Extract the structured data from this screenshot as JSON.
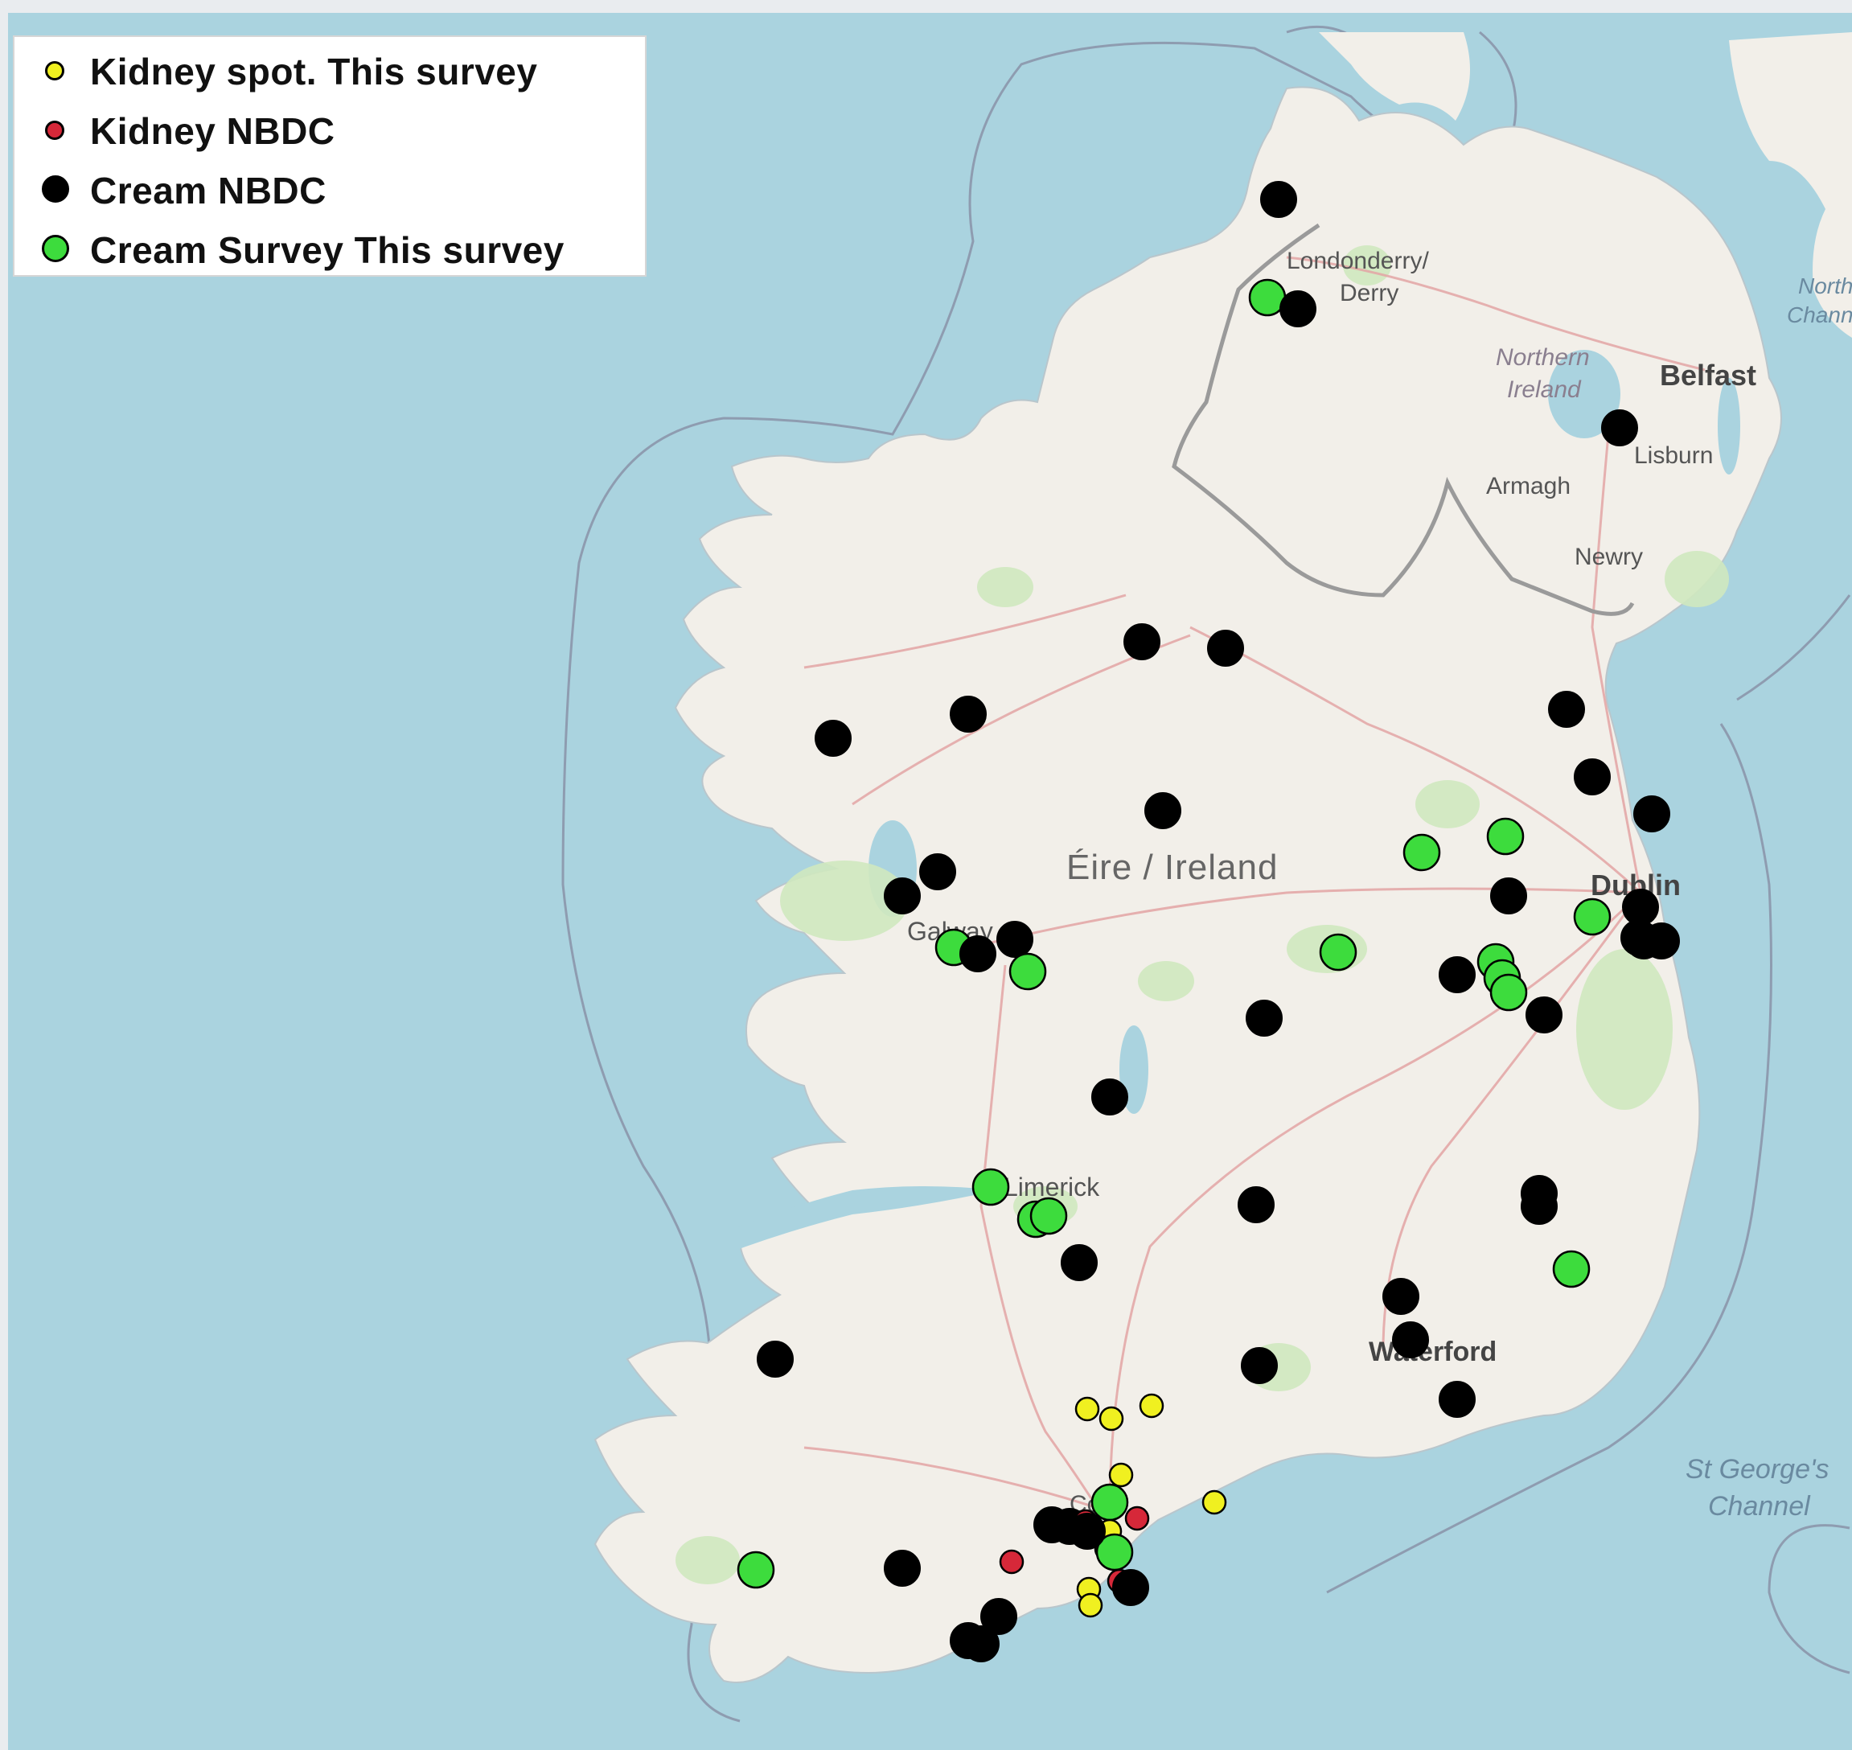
{
  "legend": {
    "items": [
      {
        "label": "Kidney spot. This survey",
        "color": "#f0f020",
        "size": "small"
      },
      {
        "label": "Kidney NBDC",
        "color": "#d62839",
        "size": "small"
      },
      {
        "label": "Cream NBDC",
        "color": "#000000",
        "size": "large"
      },
      {
        "label": "Cream Survey This survey",
        "color": "#3ddc3d",
        "size": "large"
      }
    ]
  },
  "places": {
    "londonderry": "Londonderry/",
    "derry": "Derry",
    "northern_ireland_1": "Northern",
    "northern_ireland_2": "Ireland",
    "belfast": "Belfast",
    "lisburn": "Lisburn",
    "armagh": "Armagh",
    "newry": "Newry",
    "eire": "Éire / Ireland",
    "dublin": "Dublin",
    "galway": "Galway",
    "limerick": "Limerick",
    "waterford": "Waterford",
    "cork": "Cork",
    "st_georges_1": "St George's",
    "st_georges_2": "Channel",
    "north_channel_1": "North",
    "north_channel_2": "Channel"
  },
  "colors": {
    "sea": "#aad3df",
    "land": "#f2efe9",
    "roads": "#e8a0a0",
    "border": "#9a9a9a",
    "woodland": "#c8e6b0"
  }
}
